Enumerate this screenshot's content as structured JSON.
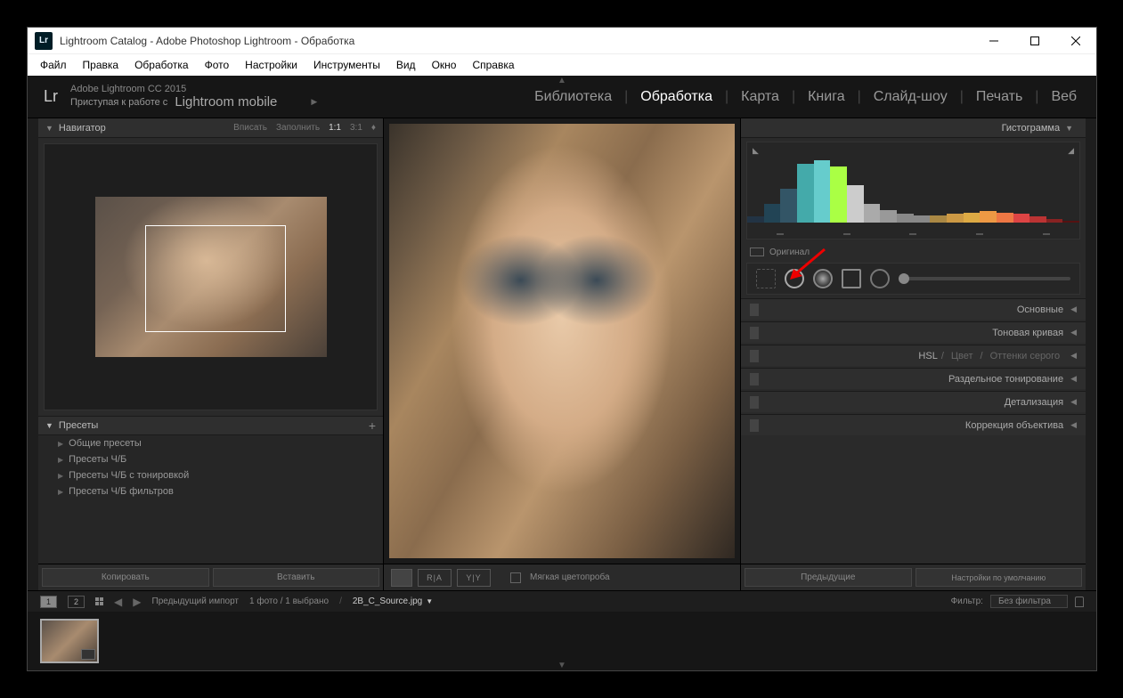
{
  "titlebar": {
    "app_icon": "Lr",
    "title": "Lightroom Catalog - Adobe Photoshop Lightroom - Обработка"
  },
  "menubar": [
    "Файл",
    "Правка",
    "Обработка",
    "Фото",
    "Настройки",
    "Инструменты",
    "Вид",
    "Окно",
    "Справка"
  ],
  "header": {
    "logo": "Lr",
    "line1": "Adobe Lightroom CC 2015",
    "line2_prefix": "Приступая к работе с",
    "line2_mobile": "Lightroom mobile",
    "modules": [
      "Библиотека",
      "Обработка",
      "Карта",
      "Книга",
      "Слайд-шоу",
      "Печать",
      "Веб"
    ],
    "active_module": 1
  },
  "navigator": {
    "title": "Навигатор",
    "options": [
      "Вписать",
      "Заполнить",
      "1:1",
      "3:1"
    ]
  },
  "presets": {
    "title": "Пресеты",
    "items": [
      "Общие пресеты",
      "Пресеты Ч/Б",
      "Пресеты Ч/Б с тонировкой",
      "Пресеты Ч/Б фильтров"
    ]
  },
  "left_buttons": {
    "copy": "Копировать",
    "paste": "Вставить"
  },
  "center_toolbar": {
    "compare1": "R|A",
    "compare2": "Y|Y",
    "softproof": "Мягкая цветопроба"
  },
  "right": {
    "histogram_title": "Гистограмма",
    "original_label": "Оригинал",
    "panels": [
      {
        "label": "Основные"
      },
      {
        "label": "Тоновая кривая"
      },
      {
        "label_parts": [
          "HSL",
          "/",
          "Цвет",
          "/",
          "Оттенки серого"
        ]
      },
      {
        "label": "Раздельное тонирование"
      },
      {
        "label": "Детализация"
      },
      {
        "label": "Коррекция объектива"
      }
    ],
    "prev_btn": "Предыдущие",
    "defaults_btn": "Настройки по умолчанию"
  },
  "filmstrip_header": {
    "prev_import": "Предыдущий импорт",
    "count": "1 фото / 1 выбрано",
    "filename": "2B_C_Source.jpg",
    "filter_label": "Фильтр:",
    "filter_value": "Без фильтра"
  }
}
